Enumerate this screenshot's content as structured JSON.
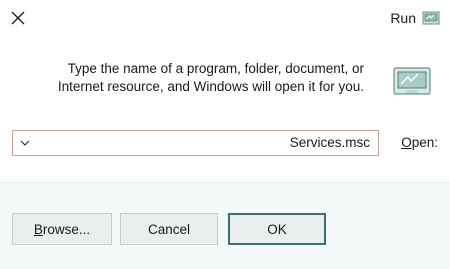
{
  "window": {
    "title": "Run",
    "title_icon": "run-app-icon",
    "close_icon": "close-icon"
  },
  "description": {
    "line1": "Type the name of a program, folder, document, or",
    "line2": "Internet resource, and Windows will open it for you."
  },
  "open_field": {
    "label_underlined": "O",
    "label_rest": "pen:",
    "value": "Services.msc",
    "dropdown_icon": "chevron-down-icon"
  },
  "buttons": {
    "ok": "OK",
    "cancel": "Cancel",
    "browse_underlined": "B",
    "browse_rest": "rowse..."
  },
  "colors": {
    "footer_bg": "#f3f9f9",
    "combo_border": "#c9a39a",
    "ok_border": "#3a6f6a"
  }
}
